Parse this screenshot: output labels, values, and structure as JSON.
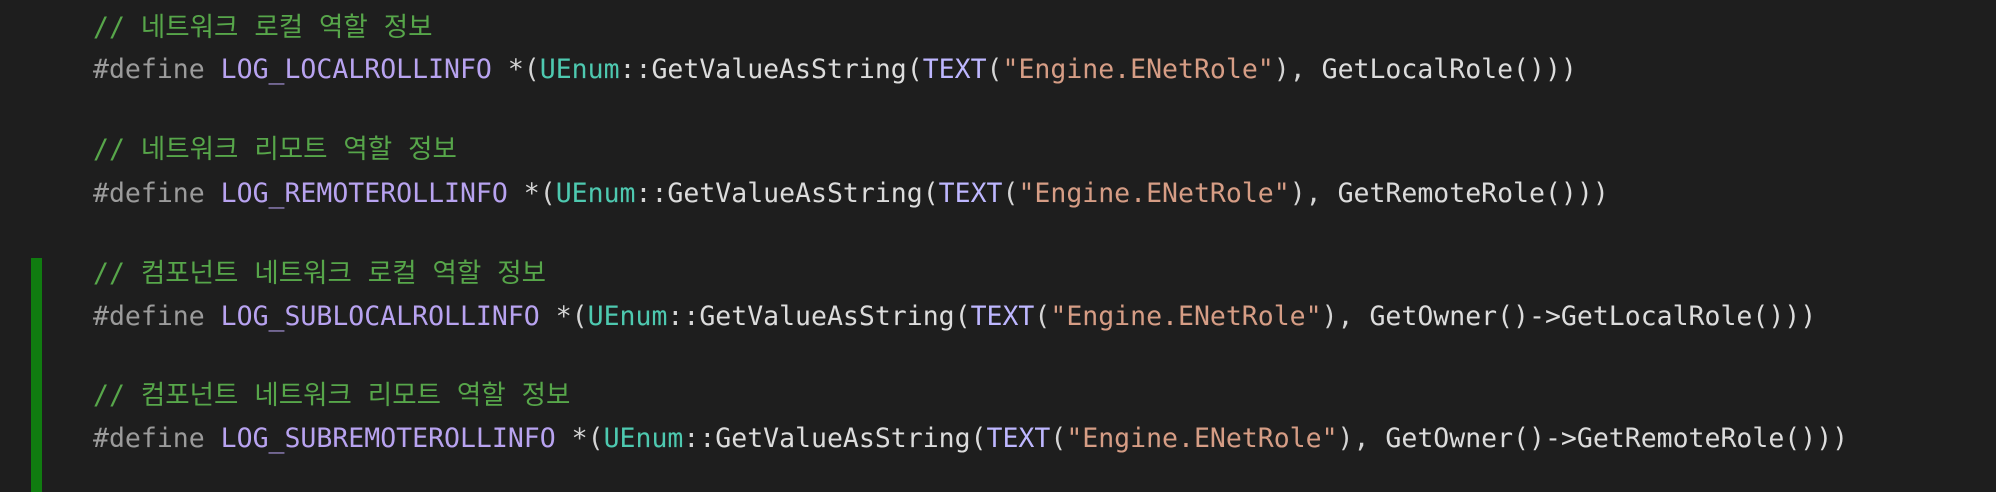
{
  "colors": {
    "background": "#1e1e1e",
    "comment": "#57a64a",
    "preprocessor": "#9b9b9b",
    "macro": "#b8a3f0",
    "type": "#4ec9b0",
    "string": "#d69d85",
    "text": "#dcdcdc",
    "change_bar": "#107c10"
  },
  "blocks": [
    {
      "comment": "// 네트워크 로컬 역할 정보",
      "directive": "#define",
      "macro_name": "LOG_LOCALROLLINFO",
      "deref_open": " *(",
      "type": "UEnum",
      "scope": "::",
      "func": "GetValueAsString(",
      "text_macro": "TEXT",
      "text_open": "(",
      "string": "\"Engine.ENetRole\"",
      "after_string": "), ",
      "call": "GetLocalRole()))"
    },
    {
      "comment": "// 네트워크 리모트 역할 정보",
      "directive": "#define",
      "macro_name": "LOG_REMOTEROLLINFO",
      "deref_open": " *(",
      "type": "UEnum",
      "scope": "::",
      "func": "GetValueAsString(",
      "text_macro": "TEXT",
      "text_open": "(",
      "string": "\"Engine.ENetRole\"",
      "after_string": "), ",
      "call": "GetRemoteRole()))"
    },
    {
      "comment": "// 컴포넌트 네트워크 로컬 역할 정보",
      "directive": "#define",
      "macro_name": "LOG_SUBLOCALROLLINFO",
      "deref_open": " *(",
      "type": "UEnum",
      "scope": "::",
      "func": "GetValueAsString(",
      "text_macro": "TEXT",
      "text_open": "(",
      "string": "\"Engine.ENetRole\"",
      "after_string": "), ",
      "call": "GetOwner()->GetLocalRole()))"
    },
    {
      "comment": "// 컴포넌트 네트워크 리모트 역할 정보",
      "directive": "#define",
      "macro_name": "LOG_SUBREMOTEROLLINFO",
      "deref_open": " *(",
      "type": "UEnum",
      "scope": "::",
      "func": "GetValueAsString(",
      "text_macro": "TEXT",
      "text_open": "(",
      "string": "\"Engine.ENetRole\"",
      "after_string": "), ",
      "call": "GetOwner()->GetRemoteRole()))"
    }
  ]
}
